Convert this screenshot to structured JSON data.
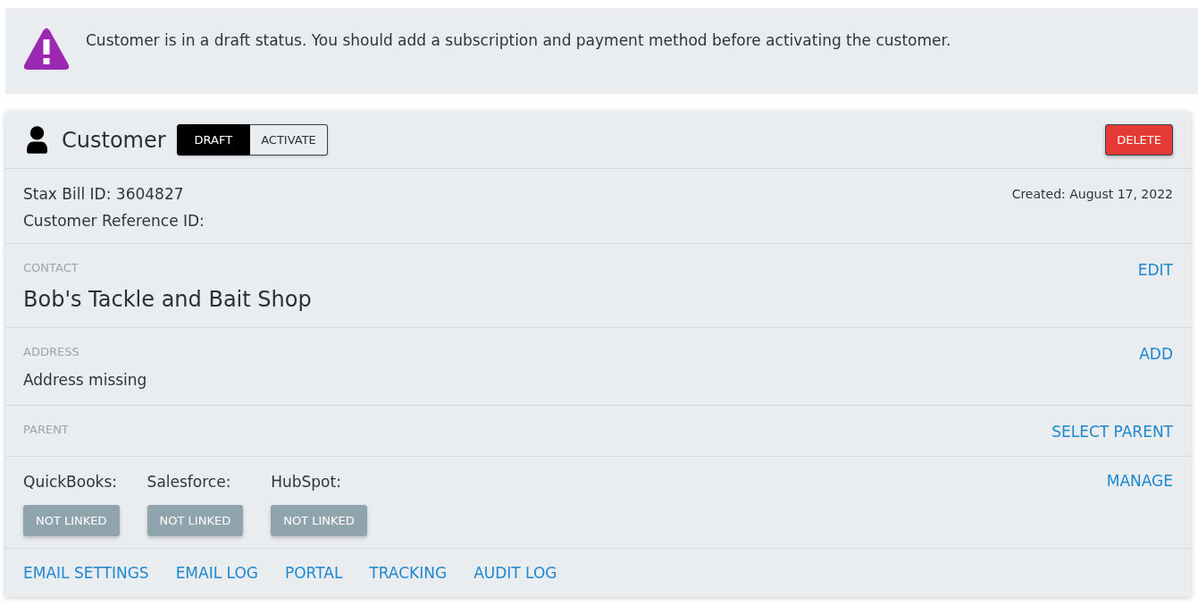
{
  "alert": {
    "message": "Customer is in a draft status. You should add a subscription and payment method before activating the customer."
  },
  "customer_card": {
    "title": "Customer",
    "status_toggle": [
      {
        "label": "DRAFT",
        "selected": true
      },
      {
        "label": "ACTIVATE",
        "selected": false
      }
    ],
    "delete_button": "DELETE",
    "ids": [
      "Stax Bill ID: 3604827",
      "Customer Reference ID:"
    ],
    "created": "Created: August 17, 2022",
    "sections": [
      {
        "kind": "title",
        "label": "CONTACT",
        "value": "Bob's Tackle and Bait Shop",
        "action": "EDIT"
      },
      {
        "kind": "text",
        "label": "ADDRESS",
        "value": "Address missing",
        "action": "ADD"
      },
      {
        "kind": "empty",
        "label": "PARENT",
        "action": "SELECT PARENT"
      }
    ],
    "integrations": {
      "items": [
        {
          "name": "QuickBooks:",
          "status": "NOT LINKED"
        },
        {
          "name": "Salesforce:",
          "status": "NOT LINKED"
        },
        {
          "name": "HubSpot:",
          "status": "NOT LINKED"
        }
      ],
      "action": "MANAGE"
    },
    "footer_links": [
      "EMAIL SETTINGS",
      "EMAIL LOG",
      "PORTAL",
      "TRACKING",
      "AUDIT LOG"
    ]
  }
}
